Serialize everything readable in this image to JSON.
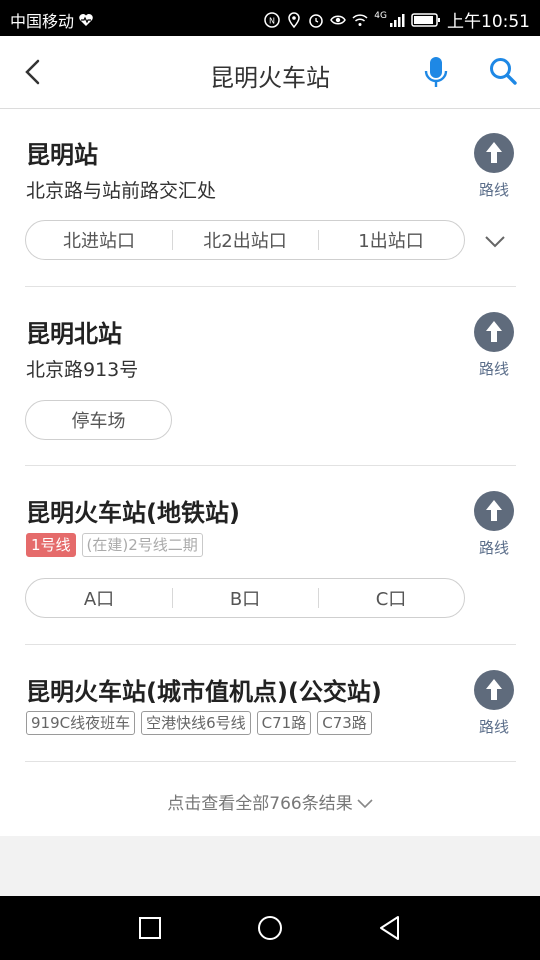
{
  "status_bar": {
    "carrier": "中国移动",
    "network": "4G",
    "time": "上午10:51"
  },
  "header": {
    "title": "昆明火车站",
    "icons": [
      "back-icon",
      "microphone-icon",
      "search-icon"
    ]
  },
  "results": [
    {
      "title": "昆明站",
      "address": "北京路与站前路交汇处",
      "route_label": "路线",
      "entrances": [
        "北进站口",
        "北2出站口",
        "1出站口"
      ]
    },
    {
      "title": "昆明北站",
      "address": "北京路913号",
      "route_label": "路线",
      "entrances": [
        "停车场"
      ]
    },
    {
      "title": "昆明火车站(地铁站)",
      "lines": [
        "1号线",
        "(在建)2号线二期"
      ],
      "route_label": "路线",
      "entrances": [
        "A口",
        "B口",
        "C口"
      ]
    },
    {
      "title": "昆明火车站(城市值机点)(公交站)",
      "lines": [
        "919C线夜班车",
        "空港快线6号线",
        "C71路",
        "C73路"
      ],
      "route_label": "路线"
    }
  ],
  "more_results": "点击查看全部766条结果",
  "colors": {
    "accent_blue": "#1e88e5",
    "route_circle": "#5f6b7c",
    "subway_line_red": "#e56b6b"
  }
}
